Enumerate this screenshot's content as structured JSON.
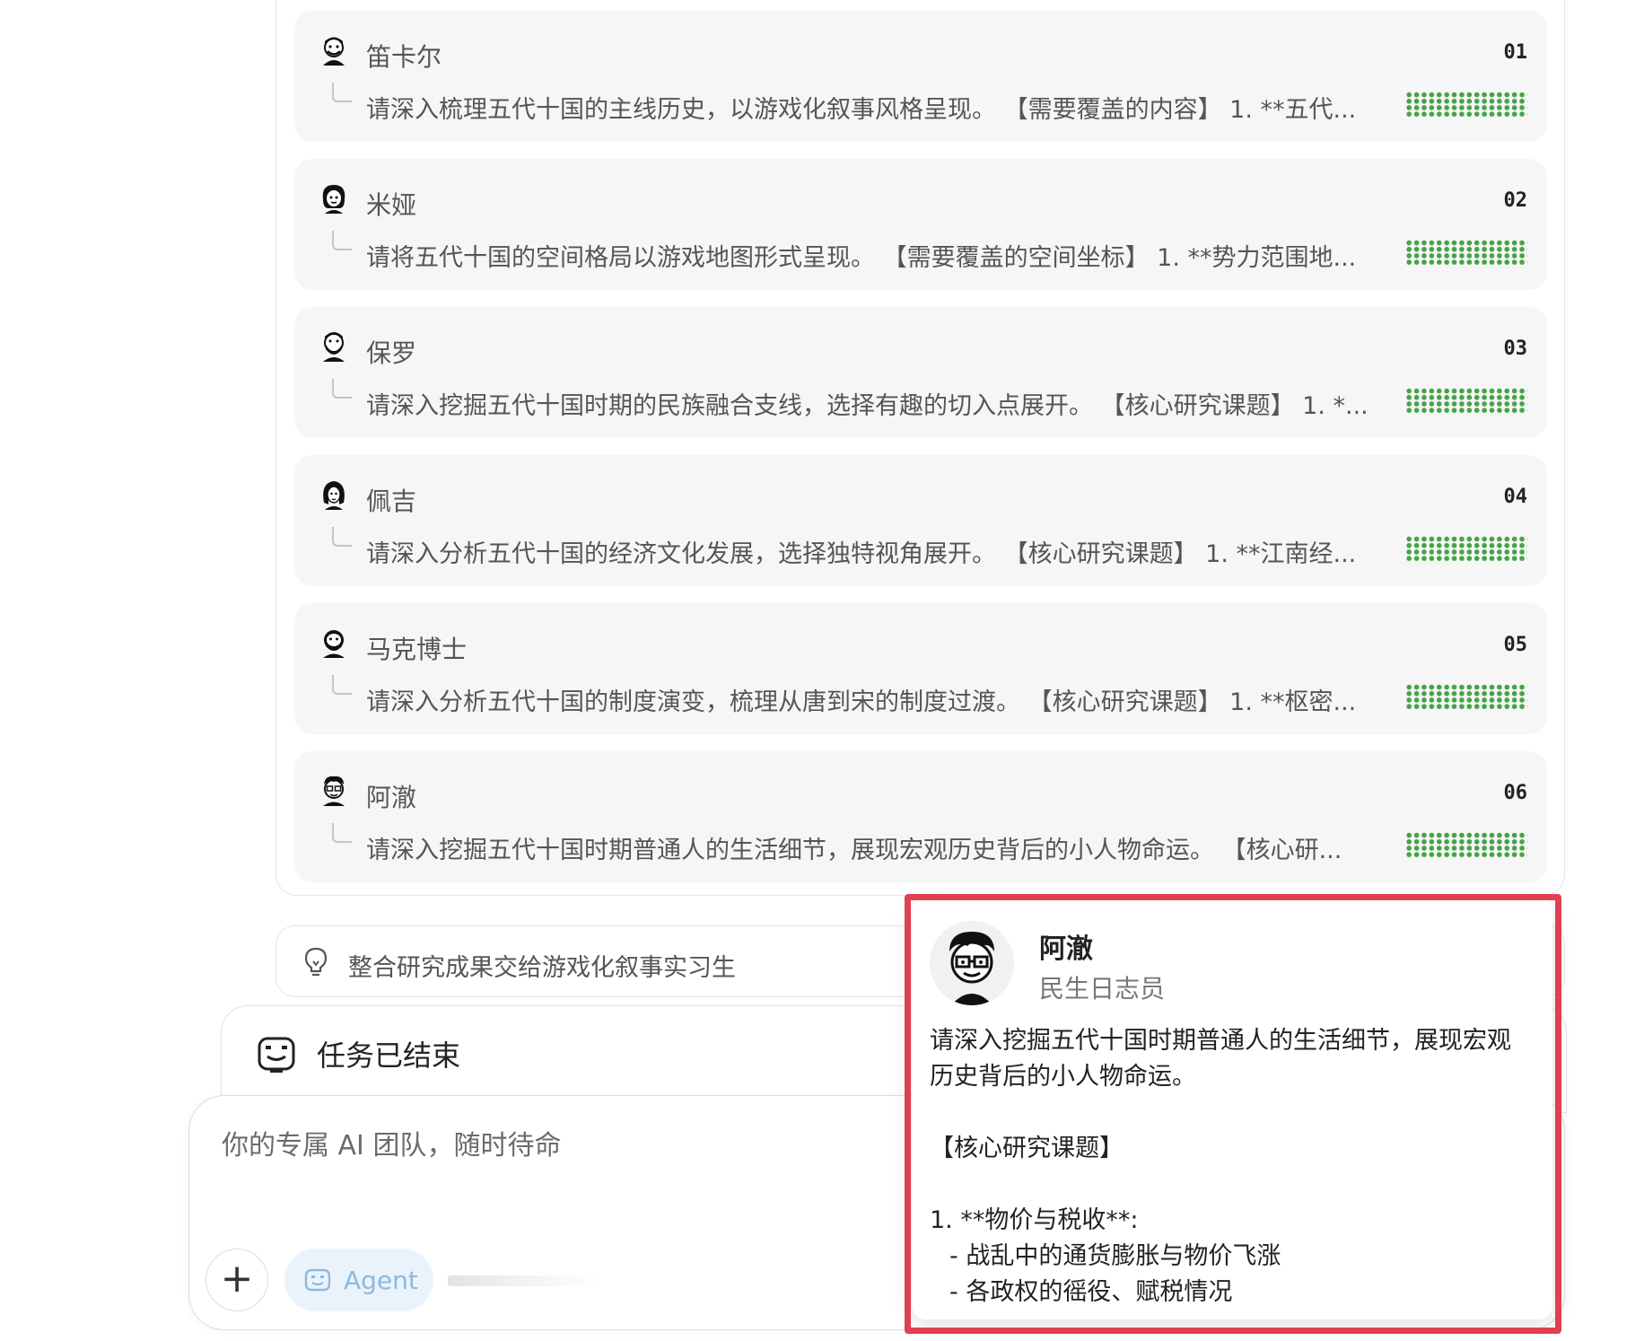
{
  "tasks": [
    {
      "name": "笛卡尔",
      "num": "01",
      "prompt": "请深入梳理五代十国的主线历史，以游戏化叙事风格呈现。 【需要覆盖的内容】 1. **五代..."
    },
    {
      "name": "米娅",
      "num": "02",
      "prompt": "请将五代十国的空间格局以游戏地图形式呈现。 【需要覆盖的空间坐标】 1. **势力范围地..."
    },
    {
      "name": "保罗",
      "num": "03",
      "prompt": "请深入挖掘五代十国时期的民族融合支线，选择有趣的切入点展开。 【核心研究课题】 1. *..."
    },
    {
      "name": "佩吉",
      "num": "04",
      "prompt": "请深入分析五代十国的经济文化发展，选择独特视角展开。 【核心研究课题】 1. **江南经..."
    },
    {
      "name": "马克博士",
      "num": "05",
      "prompt": "请深入分析五代十国的制度演变，梳理从唐到宋的制度过渡。 【核心研究课题】 1. **枢密..."
    },
    {
      "name": "阿澈",
      "num": "06",
      "prompt": "请深入挖掘五代十国时期普通人的生活细节，展现宏观历史背后的小人物命运。 【核心研..."
    }
  ],
  "progress_color": "#45a346",
  "step": {
    "label": "整合研究成果交给游戏化叙事实习生",
    "icon": "lightbulb-icon"
  },
  "status": {
    "label": "任务已结束",
    "icon": "robot-icon"
  },
  "composer": {
    "placeholder": "你的专属 AI 团队，随时待命",
    "add_icon": "plus-icon",
    "agent_label": "Agent"
  },
  "popup": {
    "name": "阿澈",
    "role": "民生日志员",
    "lines": [
      "请深入挖掘五代十国时期普通人的生活细节，展现宏观历史背后的小人物命运。",
      "",
      "【核心研究课题】",
      "",
      "1. **物价与税收**:",
      "- 战乱中的通货膨胀与物价飞涨",
      "- 各政权的徭役、赋税情况"
    ],
    "highlight_color": "#e0404f"
  }
}
